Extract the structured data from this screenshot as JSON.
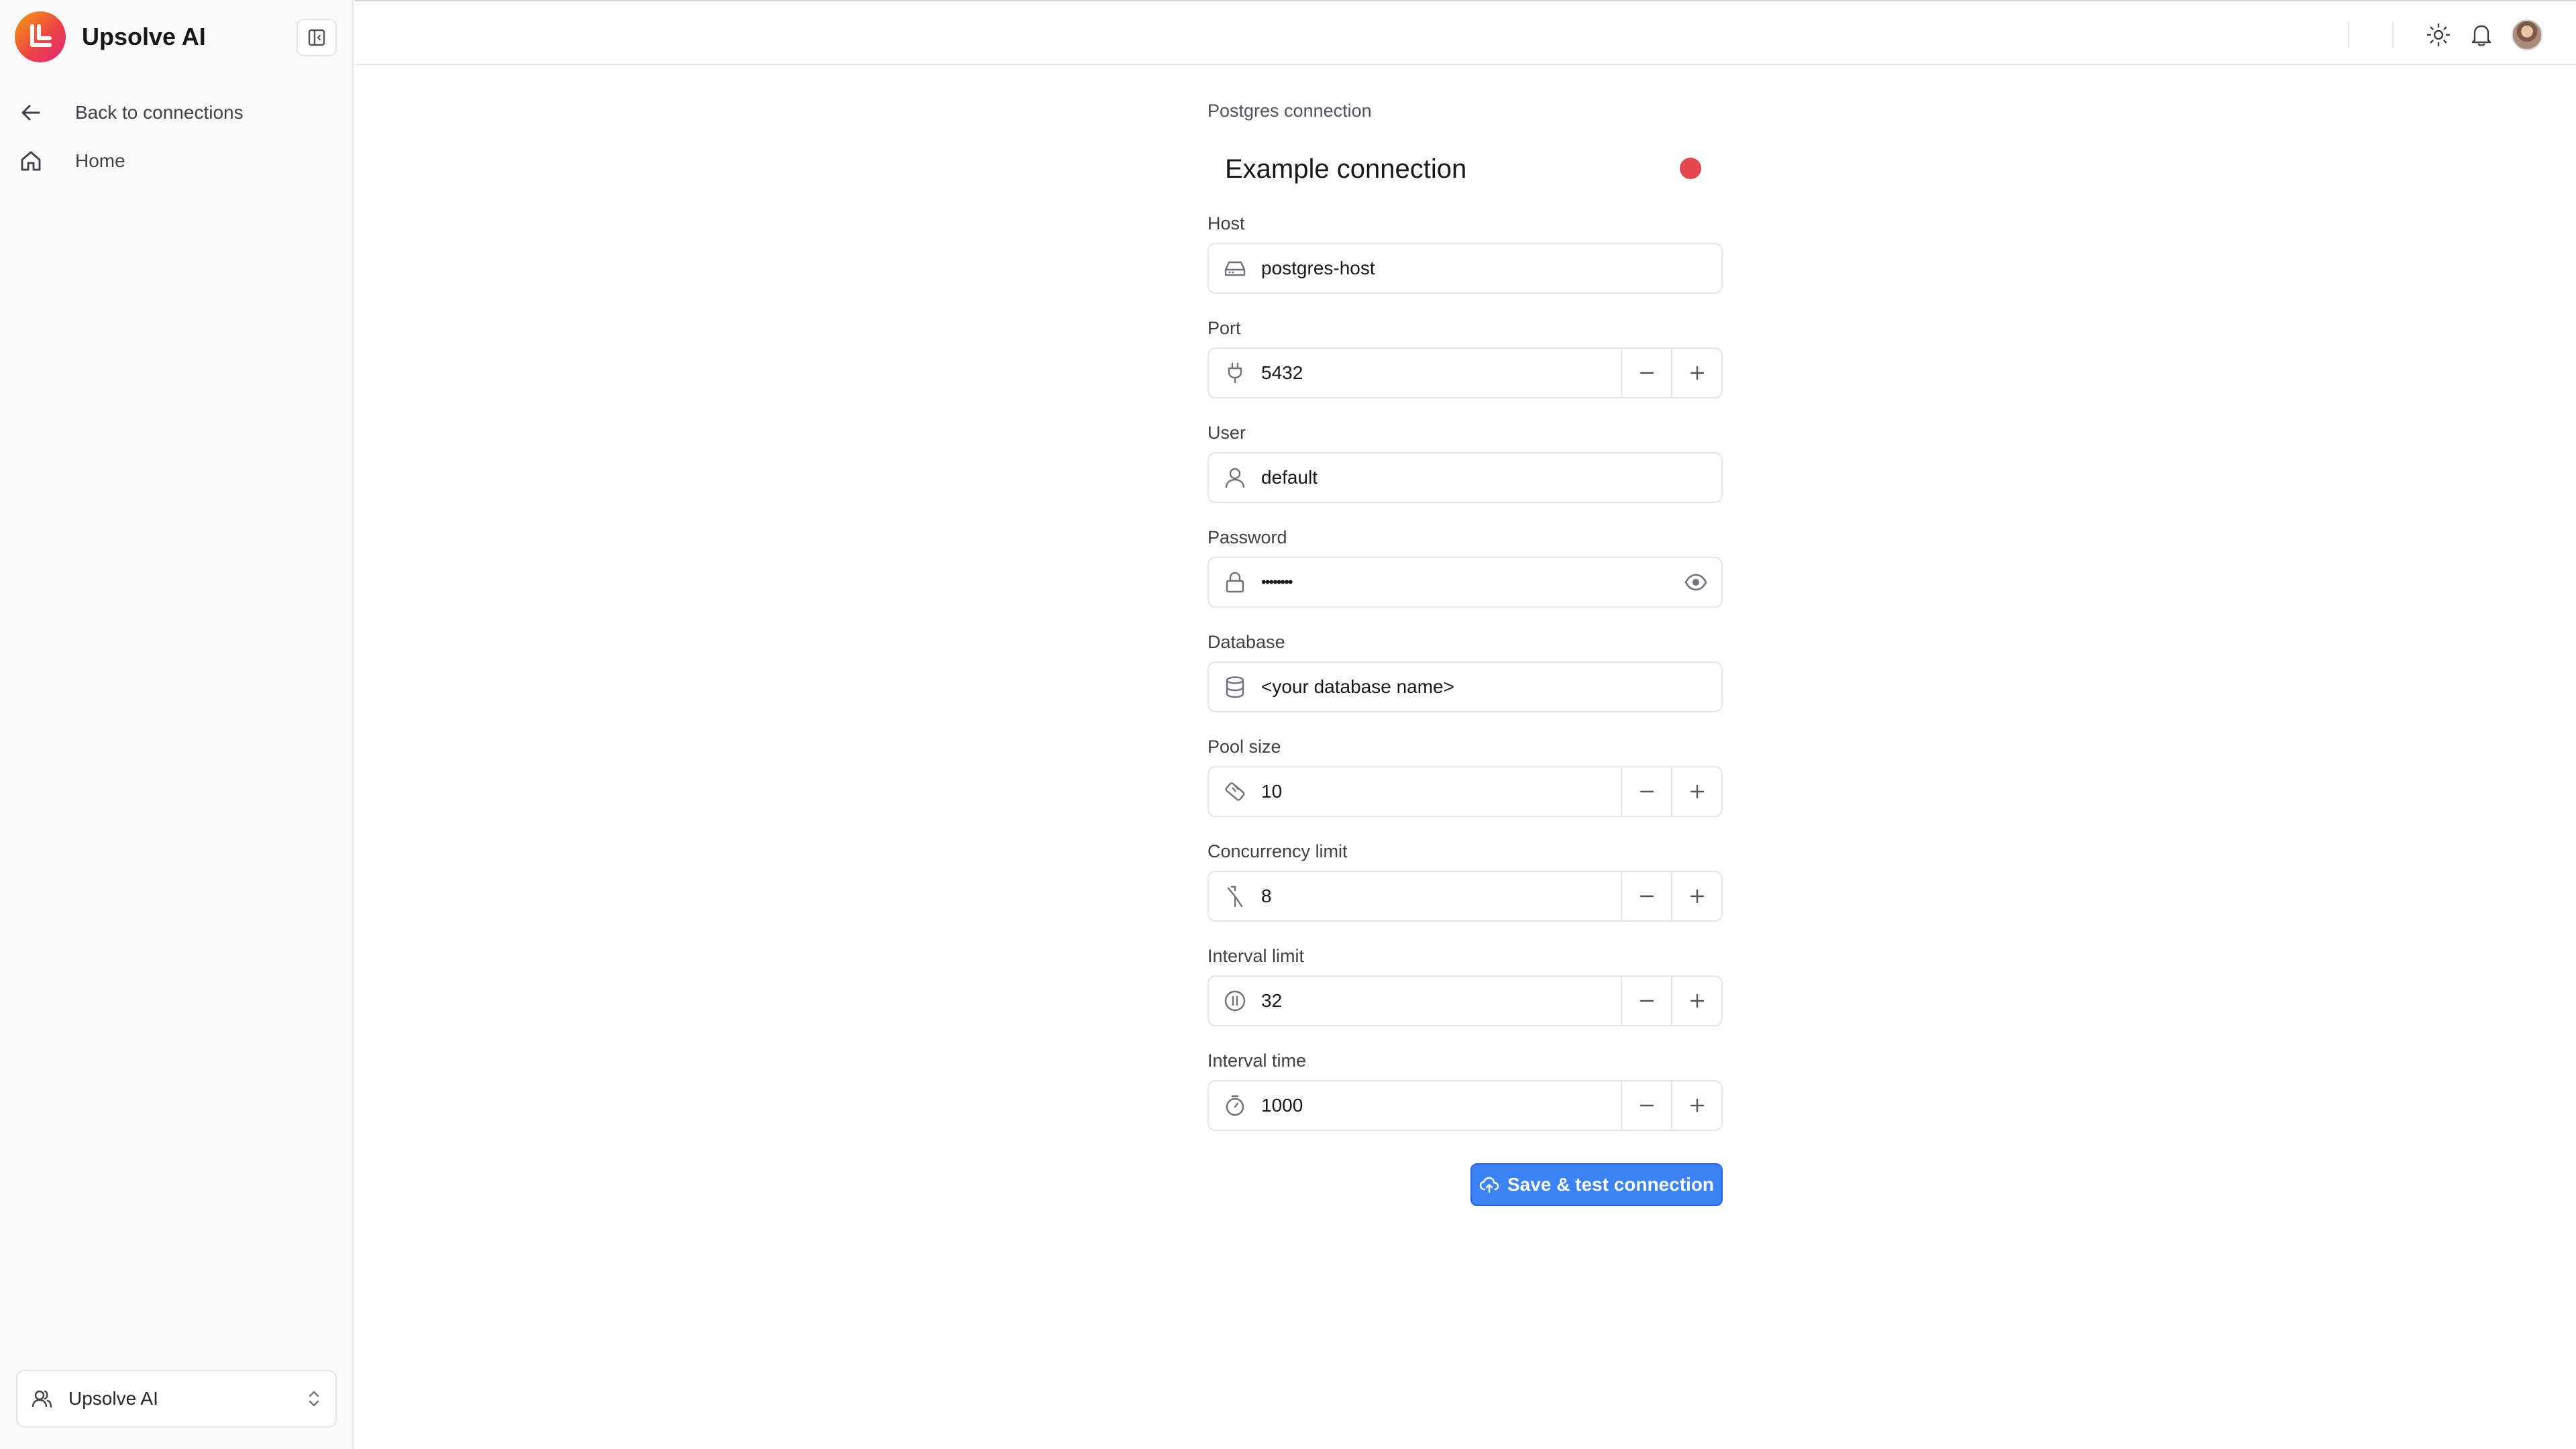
{
  "sidebar": {
    "brand_name": "Upsolve AI",
    "nav": [
      {
        "label": "Back to connections",
        "icon": "arrow-left-icon"
      },
      {
        "label": "Home",
        "icon": "home-icon"
      }
    ],
    "workspace_label": "Upsolve AI"
  },
  "form": {
    "kicker": "Postgres connection",
    "connection_name": "Example connection",
    "status_color": "#e5484d",
    "fields": {
      "host": {
        "label": "Host",
        "value": "postgres-host",
        "icon": "server-icon"
      },
      "port": {
        "label": "Port",
        "value": "5432",
        "icon": "plug-icon"
      },
      "user": {
        "label": "User",
        "value": "default",
        "icon": "user-icon"
      },
      "password": {
        "label": "Password",
        "value": "••••••••",
        "icon": "lock-icon"
      },
      "database": {
        "label": "Database",
        "value": "<your database name>",
        "icon": "database-icon"
      },
      "pool_size": {
        "label": "Pool size",
        "value": "10",
        "icon": "pool-icon"
      },
      "concurrency_limit": {
        "label": "Concurrency limit",
        "value": "8",
        "icon": "split-icon"
      },
      "interval_limit": {
        "label": "Interval limit",
        "value": "32",
        "icon": "pause-circle-icon"
      },
      "interval_time": {
        "label": "Interval time",
        "value": "1000",
        "icon": "timer-icon"
      }
    },
    "save_label": "Save & test connection"
  },
  "colors": {
    "accent": "#3b82f6",
    "status_error": "#e5484d"
  }
}
